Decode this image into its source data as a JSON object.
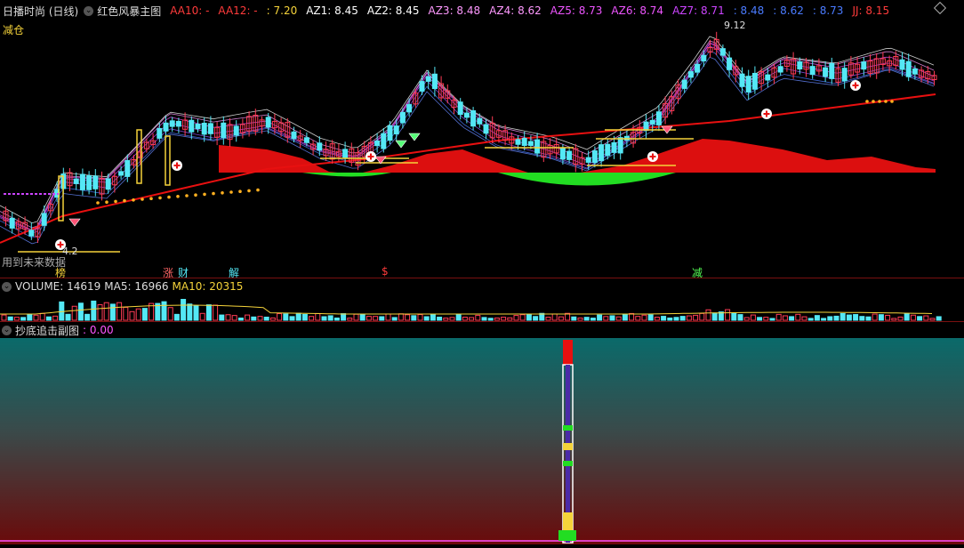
{
  "colors": {
    "up": "#ff3b55",
    "down": "#54e8f5",
    "yellow": "#f5d33a",
    "magenta": "#ff55ff",
    "white": "#ffffff",
    "blue": "#4a7bff",
    "purple": "#b066ff",
    "red": "#e81010",
    "green": "#22dd22"
  },
  "main_header": {
    "period": "日播时尚 (日线)",
    "indicator": "红色风暴主图",
    "values": [
      {
        "label": "AA10: -",
        "color": "#ff3b3b"
      },
      {
        "label": "AA12: -",
        "color": "#ff3b3b"
      },
      {
        "label": ": 7.20",
        "color": "#f5d33a"
      },
      {
        "label": "AZ1: 8.45",
        "color": "#ffffff"
      },
      {
        "label": "AZ2: 8.45",
        "color": "#ffffff"
      },
      {
        "label": "AZ3: 8.48",
        "color": "#ff99ff"
      },
      {
        "label": "AZ4: 8.62",
        "color": "#ff99ff"
      },
      {
        "label": "AZ5: 8.73",
        "color": "#ee55ff"
      },
      {
        "label": "AZ6: 8.74",
        "color": "#ee55ff"
      },
      {
        "label": "AZ7: 8.71",
        "color": "#cc44ff"
      },
      {
        "label": ": 8.48",
        "color": "#4a7bff"
      },
      {
        "label": ": 8.62",
        "color": "#4a7bff"
      },
      {
        "label": ": 8.73",
        "color": "#4a7bff"
      },
      {
        "label": "JJ: 8.15",
        "color": "#ff3b3b"
      }
    ]
  },
  "main_labels": {
    "reduce_position": "减仓",
    "high_price": "9.12",
    "low_price": "4.2",
    "future_data_note": "用到未来数据"
  },
  "event_tags": [
    {
      "text": "榜",
      "color": "#f5d33a"
    },
    {
      "text": "涨",
      "color": "#ff6666"
    },
    {
      "text": "财",
      "color": "#54e8f5"
    },
    {
      "text": "解",
      "color": "#54e8f5"
    },
    {
      "text": "$",
      "color": "#ff3b3b"
    },
    {
      "text": "减",
      "color": "#55ff55"
    }
  ],
  "volume_header": {
    "title": "VOLUME: 14619",
    "ma5": "MA5: 16966",
    "ma10": "MA10: 20315"
  },
  "sub_header": {
    "title": "抄底追击副图",
    "value": ": 0.00"
  }
}
